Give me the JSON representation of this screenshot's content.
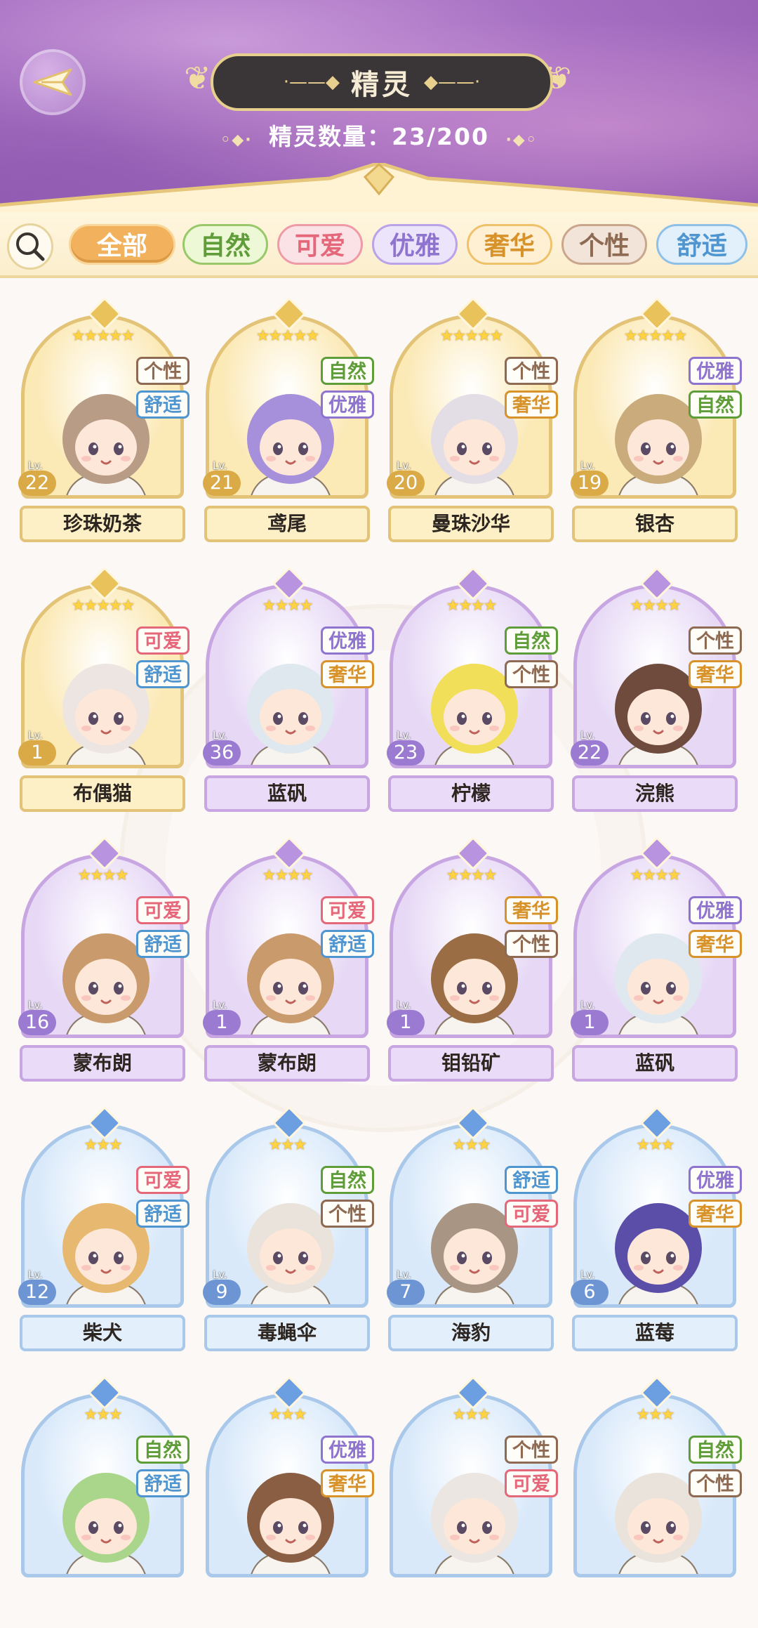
{
  "header": {
    "title": "精灵",
    "count_label": "精灵数量：23/200"
  },
  "filters": [
    {
      "label": "全部",
      "bg": "#f2b15c",
      "border": "#f9d69a",
      "color": "#ffffff",
      "selected": true
    },
    {
      "label": "自然",
      "bg": "#ecf8d6",
      "border": "#99c86a",
      "color": "#5f9c3a",
      "selected": false
    },
    {
      "label": "可爱",
      "bg": "#fbe2e6",
      "border": "#ef9aa7",
      "color": "#e5677a",
      "selected": false
    },
    {
      "label": "优雅",
      "bg": "#ece4fb",
      "border": "#b9a2e8",
      "color": "#8f74cf",
      "selected": false
    },
    {
      "label": "奢华",
      "bg": "#fff0d3",
      "border": "#efc16b",
      "color": "#d7922a",
      "selected": false
    },
    {
      "label": "个性",
      "bg": "#f2e4d8",
      "border": "#c9a68c",
      "color": "#8e6a52",
      "selected": false
    },
    {
      "label": "舒适",
      "bg": "#e1f0fb",
      "border": "#8fc0e8",
      "color": "#4f95cf",
      "selected": false
    }
  ],
  "tag_colors": {
    "自然": "#5f9c3a",
    "可爱": "#e5677a",
    "优雅": "#8f74cf",
    "奢华": "#d7922a",
    "个性": "#8e6a52",
    "舒适": "#4f95cf"
  },
  "rarity_styles": {
    "gold": {
      "frame_bg": "#fbe9b6",
      "border": "#e2c377",
      "name_bg": "#fdf0c6",
      "lv_bg": "#d9aa45",
      "crown": "#e9c25c"
    },
    "purple": {
      "frame_bg": "#e7d9f6",
      "border": "#c8a6e2",
      "name_bg": "#eadcf8",
      "lv_bg": "#9b7ad1",
      "crown": "#b893e0"
    },
    "blue": {
      "frame_bg": "#d9e9fa",
      "border": "#a9c8ea",
      "name_bg": "#e3effb",
      "lv_bg": "#6d95d4",
      "crown": "#6c9ee2"
    }
  },
  "spirits": [
    {
      "name": "珍珠奶茶",
      "level": "22",
      "stars": "★★★★★",
      "rarity": "gold",
      "tags": [
        "个性",
        "舒适"
      ],
      "hair": "#b89c86"
    },
    {
      "name": "鸢尾",
      "level": "21",
      "stars": "★★★★★",
      "rarity": "gold",
      "tags": [
        "自然",
        "优雅"
      ],
      "hair": "#a690dc"
    },
    {
      "name": "曼珠沙华",
      "level": "20",
      "stars": "★★★★★",
      "rarity": "gold",
      "tags": [
        "个性",
        "奢华"
      ],
      "hair": "#e3dde6"
    },
    {
      "name": "银杏",
      "level": "19",
      "stars": "★★★★★",
      "rarity": "gold",
      "tags": [
        "优雅",
        "自然"
      ],
      "hair": "#c9ab7c"
    },
    {
      "name": "布偶猫",
      "level": "1",
      "stars": "★★★★★",
      "rarity": "gold",
      "tags": [
        "可爱",
        "舒适"
      ],
      "hair": "#ede5e1"
    },
    {
      "name": "蓝矾",
      "level": "36",
      "stars": "★★★★",
      "rarity": "purple",
      "tags": [
        "优雅",
        "奢华"
      ],
      "hair": "#dfe8ee"
    },
    {
      "name": "柠檬",
      "level": "23",
      "stars": "★★★★",
      "rarity": "purple",
      "tags": [
        "自然",
        "个性"
      ],
      "hair": "#f1df5a"
    },
    {
      "name": "浣熊",
      "level": "22",
      "stars": "★★★★",
      "rarity": "purple",
      "tags": [
        "个性",
        "奢华"
      ],
      "hair": "#6e4b3c"
    },
    {
      "name": "蒙布朗",
      "level": "16",
      "stars": "★★★★",
      "rarity": "purple",
      "tags": [
        "可爱",
        "舒适"
      ],
      "hair": "#c99a6b"
    },
    {
      "name": "蒙布朗",
      "level": "1",
      "stars": "★★★★",
      "rarity": "purple",
      "tags": [
        "可爱",
        "舒适"
      ],
      "hair": "#c99a6b"
    },
    {
      "name": "钼铅矿",
      "level": "1",
      "stars": "★★★★",
      "rarity": "purple",
      "tags": [
        "奢华",
        "个性"
      ],
      "hair": "#9a6d45"
    },
    {
      "name": "蓝矾",
      "level": "1",
      "stars": "★★★★",
      "rarity": "purple",
      "tags": [
        "优雅",
        "奢华"
      ],
      "hair": "#dfe8ee"
    },
    {
      "name": "柴犬",
      "level": "12",
      "stars": "★★★",
      "rarity": "blue",
      "tags": [
        "可爱",
        "舒适"
      ],
      "hair": "#e7b970"
    },
    {
      "name": "毒蝇伞",
      "level": "9",
      "stars": "★★★",
      "rarity": "blue",
      "tags": [
        "自然",
        "个性"
      ],
      "hair": "#e9e3dc"
    },
    {
      "name": "海豹",
      "level": "7",
      "stars": "★★★",
      "rarity": "blue",
      "tags": [
        "舒适",
        "可爱"
      ],
      "hair": "#a89584"
    },
    {
      "name": "蓝莓",
      "level": "6",
      "stars": "★★★",
      "rarity": "blue",
      "tags": [
        "优雅",
        "奢华"
      ],
      "hair": "#5a4ea8"
    },
    {
      "name": "",
      "level": "",
      "stars": "★★★",
      "rarity": "blue",
      "tags": [
        "自然",
        "舒适"
      ],
      "hair": "#a9d68a"
    },
    {
      "name": "",
      "level": "",
      "stars": "★★★",
      "rarity": "blue",
      "tags": [
        "优雅",
        "奢华"
      ],
      "hair": "#8a5e43"
    },
    {
      "name": "",
      "level": "",
      "stars": "★★★",
      "rarity": "blue",
      "tags": [
        "个性",
        "可爱"
      ],
      "hair": "#ece6e2"
    },
    {
      "name": "",
      "level": "",
      "stars": "★★★",
      "rarity": "blue",
      "tags": [
        "自然",
        "个性"
      ],
      "hair": "#e9e3dc"
    }
  ]
}
